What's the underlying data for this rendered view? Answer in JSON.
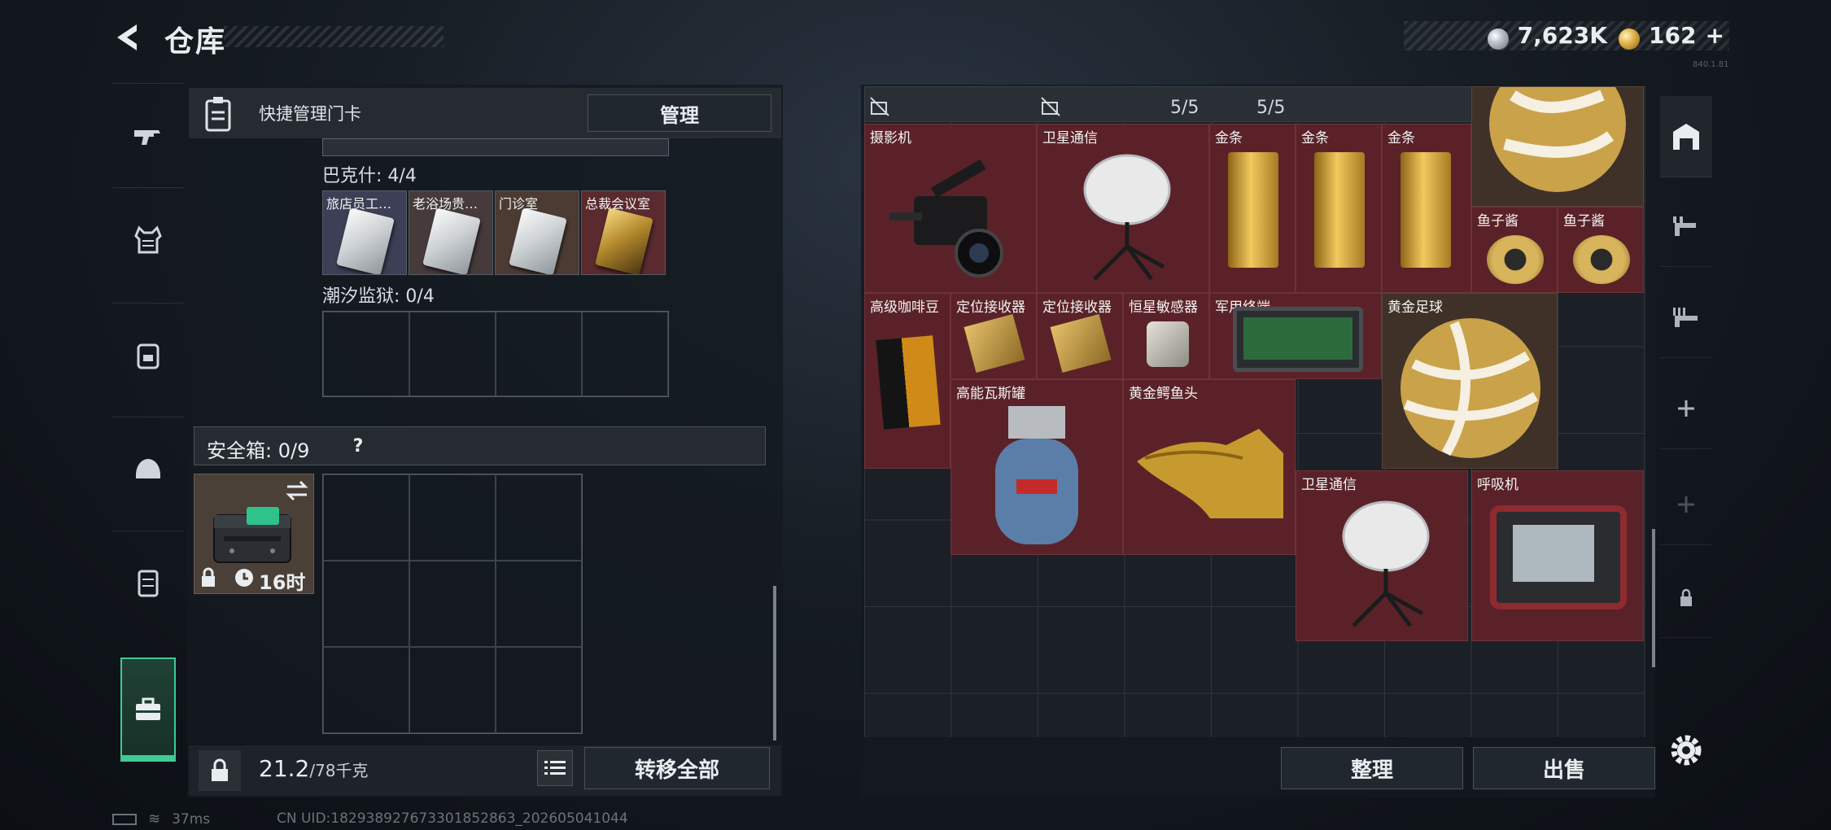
{
  "header": {
    "title": "仓库",
    "currencies": [
      {
        "icon": "silver-coin-icon",
        "value": "7,623K"
      },
      {
        "icon": "gold-coin-icon",
        "value": "162",
        "add_label": "+"
      }
    ],
    "version": "840.1.81"
  },
  "left_nav": {
    "items": [
      "weapon-icon",
      "armor-vest-icon",
      "backpack-icon",
      "helmet-icon",
      "rig-icon",
      "toolbox-icon"
    ],
    "active": "toolbox-icon"
  },
  "keycards": {
    "header_title": "快捷管理门卡",
    "manage_label": "管理",
    "groups": [
      {
        "name": "巴克什: 4/4",
        "cards": [
          {
            "label": "旅店员工…",
            "style": "silver"
          },
          {
            "label": "老浴场贵…",
            "style": "silver"
          },
          {
            "label": "门诊室",
            "style": "silver"
          },
          {
            "label": "总裁会议室",
            "style": "gold"
          }
        ]
      },
      {
        "name": "潮汐监狱: 0/4",
        "cards": []
      }
    ]
  },
  "safe_box": {
    "label": "安全箱: 0/9",
    "help_label": "?",
    "timer": "16时",
    "swap_icon": "swap-icon"
  },
  "footer_left": {
    "weight_current": "21.2",
    "weight_max": "/78千克",
    "transfer_label": "转移全部"
  },
  "storage": {
    "top_counts": [
      "5/5",
      "5/5"
    ],
    "items": [
      {
        "name": "摄影机"
      },
      {
        "name": "卫星通信"
      },
      {
        "name": "金条"
      },
      {
        "name": "金条"
      },
      {
        "name": "金条"
      },
      {
        "name": "鱼子酱"
      },
      {
        "name": "鱼子酱"
      },
      {
        "name": "高级咖啡豆"
      },
      {
        "name": "定位接收器"
      },
      {
        "name": "定位接收器"
      },
      {
        "name": "恒星敏感器"
      },
      {
        "name": "军用终端"
      },
      {
        "name": "黄金足球"
      },
      {
        "name": "高能瓦斯罐"
      },
      {
        "name": "黄金鳄鱼头"
      },
      {
        "name": "卫星通信"
      },
      {
        "name": "呼吸机"
      }
    ],
    "sort_label": "整理",
    "sell_label": "出售"
  },
  "right_nav": {
    "items": [
      "warehouse-icon",
      "gun-rack-icon",
      "gun-rack-2-icon",
      "add-icon",
      "add-disabled-icon",
      "lock-icon"
    ]
  },
  "status": {
    "ping": "37ms",
    "uid": "CN UID:182938927673301852863_202605041044"
  }
}
